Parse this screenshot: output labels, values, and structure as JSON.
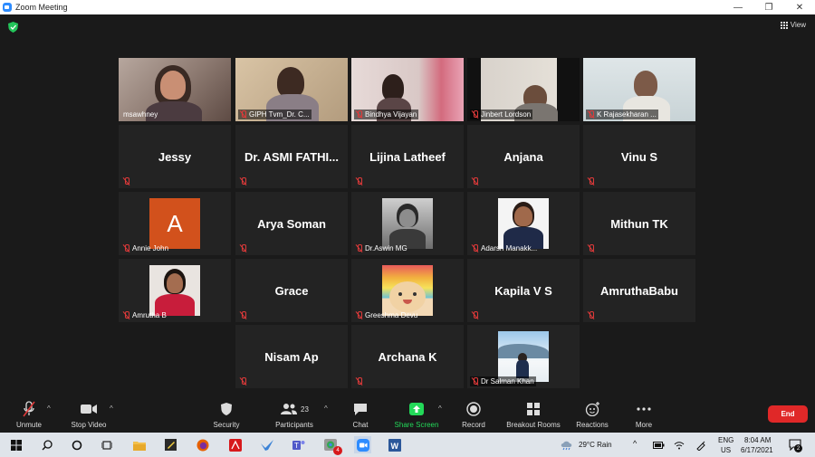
{
  "window": {
    "title": "Zoom Meeting",
    "min": "—",
    "max": "❐",
    "close": "✕"
  },
  "meeting": {
    "view_label": "View"
  },
  "tiles": [
    {
      "name": "msawhney",
      "mode": "video"
    },
    {
      "name": "GIPH Tvm_Dr. C...",
      "mode": "video"
    },
    {
      "name": "Bindhya Vijayan",
      "mode": "video"
    },
    {
      "name": "Jinbert Lordson",
      "mode": "video"
    },
    {
      "name": "K Rajasekharan ...",
      "mode": "video"
    },
    {
      "name": "Jessy",
      "mode": "name"
    },
    {
      "name": "Dr. ASMI FATHI...",
      "mode": "name"
    },
    {
      "name": "Lijina Latheef",
      "mode": "name"
    },
    {
      "name": "Anjana",
      "mode": "name"
    },
    {
      "name": "Vinu S",
      "mode": "name"
    },
    {
      "name": "Annie John",
      "mode": "avatar",
      "avatar_letter": "A"
    },
    {
      "name": "Arya Soman",
      "mode": "name"
    },
    {
      "name": "Dr.Aswin MG",
      "mode": "avatar"
    },
    {
      "name": "Adarsh Manakk...",
      "mode": "avatar"
    },
    {
      "name": "Mithun TK",
      "mode": "name"
    },
    {
      "name": "Amrutha B",
      "mode": "avatar"
    },
    {
      "name": "Grace",
      "mode": "name"
    },
    {
      "name": "Greeshma Devu",
      "mode": "avatar"
    },
    {
      "name": "Kapila V S",
      "mode": "name"
    },
    {
      "name": "AmruthaBabu",
      "mode": "name"
    },
    {
      "name": "Nisam Ap",
      "mode": "name"
    },
    {
      "name": "Archana K",
      "mode": "name"
    },
    {
      "name": "Dr Salman Khan",
      "mode": "avatar"
    }
  ],
  "toolbar": {
    "unmute": "Unmute",
    "stop_video": "Stop Video",
    "security": "Security",
    "participants": "Participants",
    "participants_count": "23",
    "chat": "Chat",
    "share_screen": "Share Screen",
    "record": "Record",
    "breakout_rooms": "Breakout Rooms",
    "reactions": "Reactions",
    "more": "More",
    "end": "End"
  },
  "taskbar": {
    "weather": "29°C Rain",
    "lang_top": "ENG",
    "lang_bottom": "US",
    "time": "8:04 AM",
    "date": "6/17/2021",
    "notif_count": "2",
    "acrobat_badge": "4"
  },
  "colors": {
    "accent_green": "#23d959",
    "end_red": "#e02828",
    "active_border": "#b8d24a",
    "tile_bg": "#232323"
  }
}
